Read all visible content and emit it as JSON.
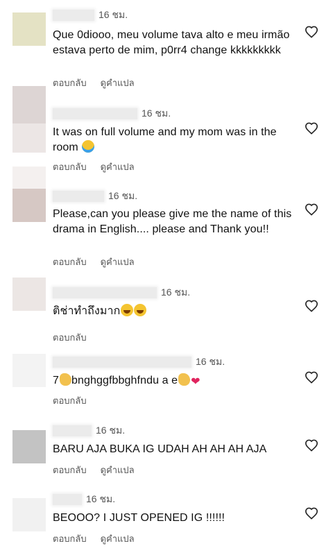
{
  "actions": {
    "reply": "ตอบกลับ",
    "translate": "ดูคำแปล"
  },
  "comments": [
    {
      "time": "16 ชม.",
      "text": "Que 0diooo, meu volume tava alto e meu irmão estava perto de mim, p0rr4 change kkkkkkkkk"
    },
    {
      "time": "16 ชม.",
      "text": "It was on full volume and my mom was in the room"
    },
    {
      "time": "16 ชม.",
      "text": "Please,can you please give me the name of this drama in English.... please and Thank you!!"
    },
    {
      "time": "16 ชม.",
      "text": "ติช่าทำถึงมาก"
    },
    {
      "time": "16 ชม.",
      "text_a": "7",
      "text_b": "bnghggfbbghfndu a e"
    },
    {
      "time": "16 ชม.",
      "text": "BARU AJA BUKA IG UDAH AH AH AH AJA"
    },
    {
      "time": "16 ชม.",
      "text": "BEOOO? I JUST OPENED IG !!!!!!"
    }
  ],
  "colors": {
    "text": "#111111",
    "muted": "#555555",
    "heart_outline": "#262626",
    "emoji_heart": "#e0245e"
  },
  "icons": {
    "like": "heart-outline-icon",
    "cry": "loudly-crying-face-emoji",
    "laugh": "grinning-squinting-face-emoji",
    "clap": "clapping-hands-emoji",
    "red_heart": "red-heart-emoji"
  }
}
